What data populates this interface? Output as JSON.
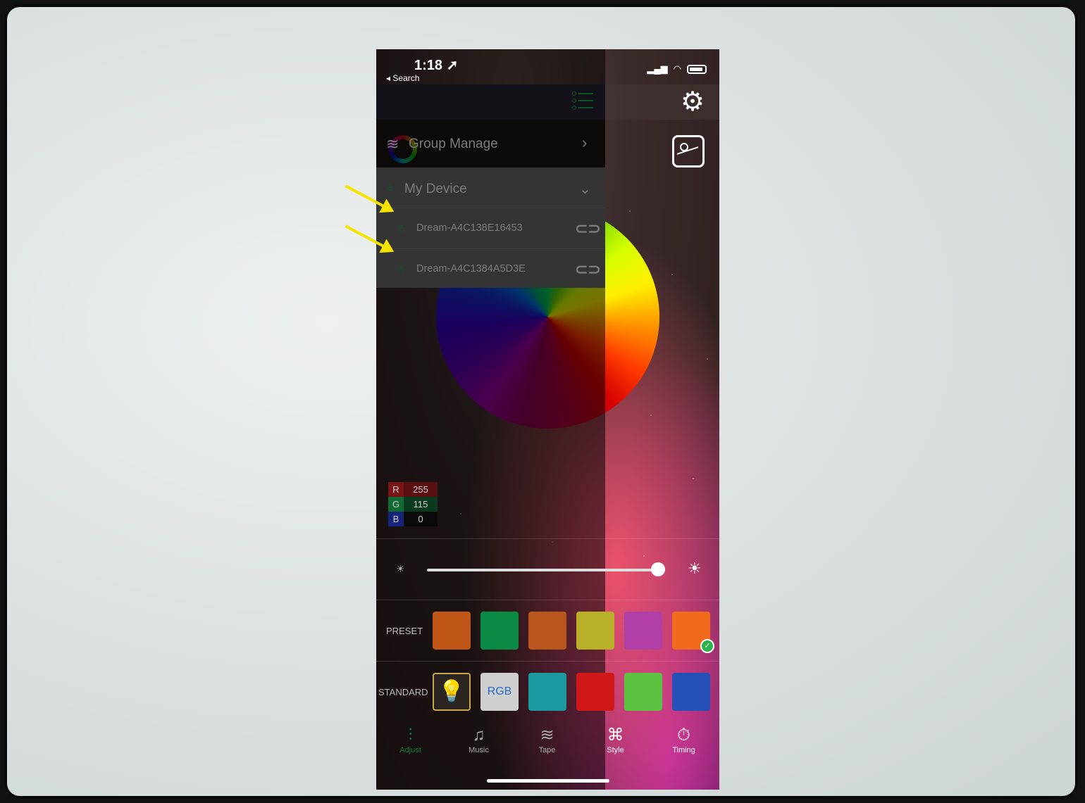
{
  "status": {
    "time": "1:18 ➚",
    "back_label": "◂ Search"
  },
  "menu": {
    "group_manage": "Group Manage",
    "my_device": "My Device",
    "devices": [
      {
        "name": "Dream-A4C138E16453"
      },
      {
        "name": "Dream-A4C1384A5D3E"
      }
    ]
  },
  "rgb": {
    "r_label": "R",
    "r": "255",
    "g_label": "G",
    "g": "115",
    "b_label": "B",
    "b": "0"
  },
  "brightness": 0.97,
  "preset": {
    "label": "PRESET",
    "colors": [
      "#c05518",
      "#0a8a45",
      "#b8561e",
      "#b8b028",
      "#b040a8",
      "#f26a1c"
    ]
  },
  "standard": {
    "label": "STANDARD",
    "rgb_label": "RGB",
    "colors": [
      "#1a9aa0",
      "#d01818",
      "#5cc040",
      "#2450b8"
    ]
  },
  "tabs": [
    {
      "label": "Adjust",
      "icon": "sliders-icon"
    },
    {
      "label": "Music",
      "icon": "music-note-icon"
    },
    {
      "label": "Tape",
      "icon": "wave-icon"
    },
    {
      "label": "Style",
      "icon": "command-icon"
    },
    {
      "label": "Timing",
      "icon": "timer-icon"
    }
  ],
  "accent": "#1fae4a",
  "annotation_color": "#f5e400"
}
